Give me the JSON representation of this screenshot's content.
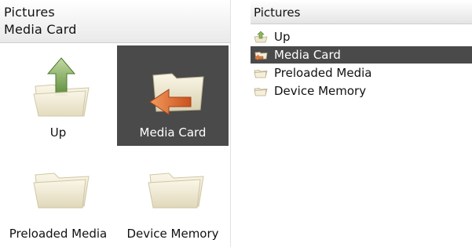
{
  "left_screen": {
    "header": {
      "line1": "Pictures",
      "line2": "Media Card"
    },
    "tiles": [
      {
        "label": "Up",
        "icon": "folder-up-icon",
        "selected": false
      },
      {
        "label": "Media Card",
        "icon": "folder-back-icon",
        "selected": true
      },
      {
        "label": "Preloaded Media",
        "icon": "folder-icon",
        "selected": false
      },
      {
        "label": "Device Memory",
        "icon": "folder-icon",
        "selected": false
      }
    ]
  },
  "right_screen": {
    "title": "Pictures",
    "items": [
      {
        "label": "Up",
        "icon": "up-arrow-folder-icon",
        "selected": false
      },
      {
        "label": "Media Card",
        "icon": "media-card-folder-icon",
        "selected": true
      },
      {
        "label": "Preloaded Media",
        "icon": "folder-icon",
        "selected": false
      },
      {
        "label": "Device Memory",
        "icon": "folder-icon",
        "selected": false
      }
    ]
  },
  "colors": {
    "selection": "#4a4a4a",
    "folder_light": "#f1ecd8",
    "arrow_green": "#7fae4a",
    "arrow_orange": "#e06a2c"
  }
}
